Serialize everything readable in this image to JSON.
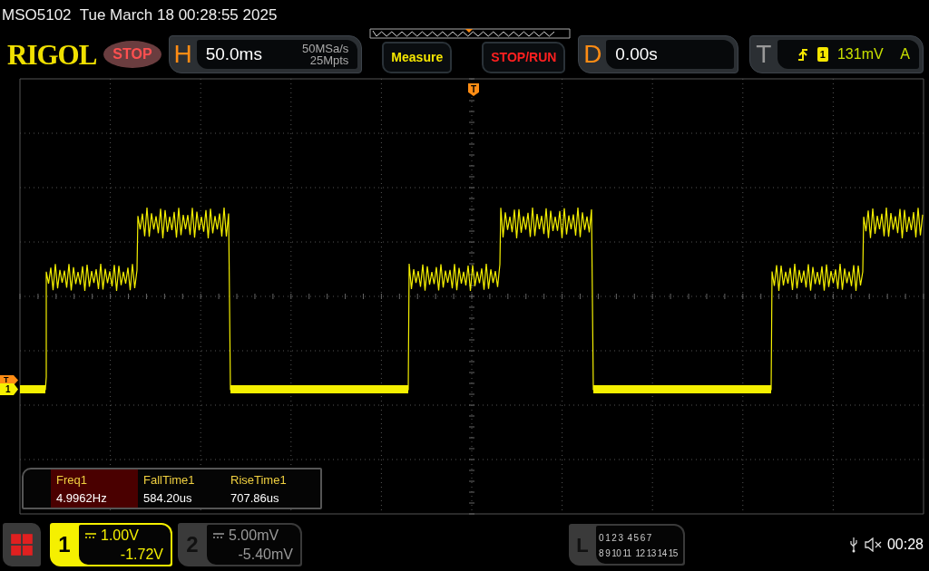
{
  "title_bar": {
    "model": "MSO5102",
    "datetime": "Tue March 18 00:28:55 2025"
  },
  "header": {
    "logo": "RIGOL",
    "run_state": "STOP",
    "horizontal": {
      "label": "H",
      "timebase": "50.0ms",
      "sample_rate": "50MSa/s",
      "memory_depth": "25Mpts"
    },
    "measure_button": "Measure",
    "stop_run_button": "STOP/RUN",
    "delay": {
      "label": "D",
      "value": "0.00s"
    },
    "trigger": {
      "label": "T",
      "source": "1",
      "level": "131mV",
      "mode": "A"
    }
  },
  "grid": {
    "trigger_position_marker": "T",
    "trigger_level_marker": "T",
    "channel_marker": "1"
  },
  "measurements": [
    {
      "name": "Freq1",
      "value": "4.9962Hz",
      "selected": true
    },
    {
      "name": "FallTime1",
      "value": "584.20us",
      "selected": false
    },
    {
      "name": "RiseTime1",
      "value": "707.86us",
      "selected": false
    }
  ],
  "channels": [
    {
      "number": "1",
      "scale": "1.00V",
      "offset": "-1.72V",
      "on": true
    },
    {
      "number": "2",
      "scale": "5.00mV",
      "offset": "-5.40mV",
      "on": false
    }
  ],
  "logic": {
    "label": "L",
    "groups": [
      "0 1 2 3",
      "4 5 6 7",
      "8 9 10 11",
      "12 13 14 15"
    ]
  },
  "status": {
    "time": "00:28"
  }
}
